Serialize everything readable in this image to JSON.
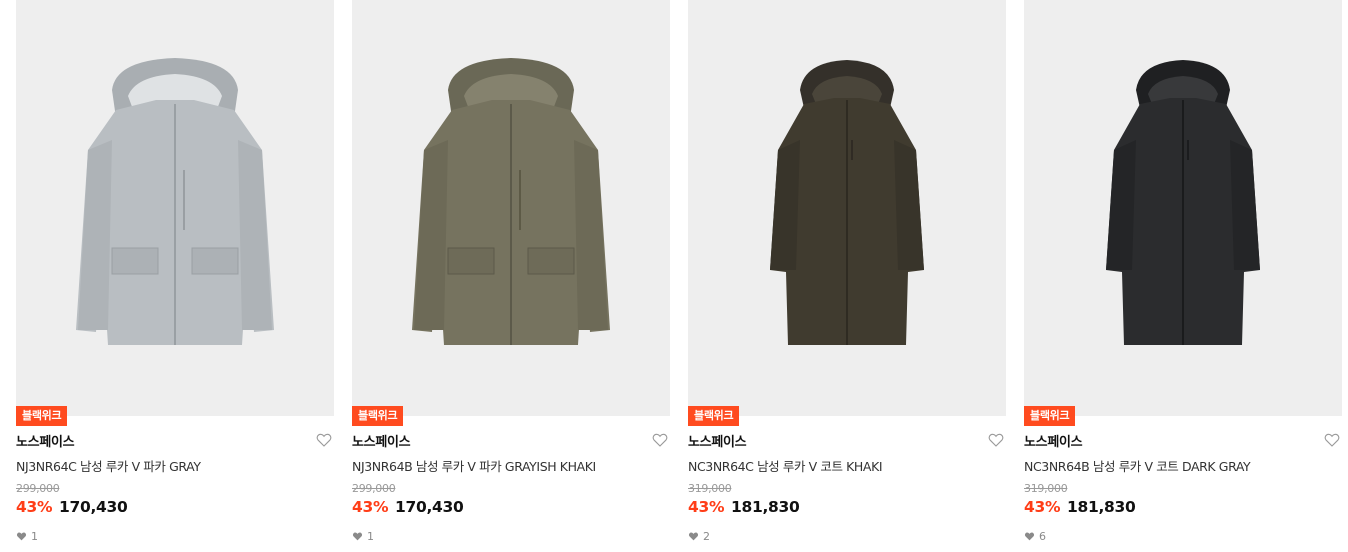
{
  "products": [
    {
      "badge": "블랙위크",
      "brand": "노스페이스",
      "name": "NJ3NR64C 남성 루카 V 파카 GRAY",
      "original_price": "299,000",
      "discount": "43%",
      "price": "170,430",
      "likes": "1",
      "image_alt": "parka-gray",
      "color": "#b9bec2"
    },
    {
      "badge": "블랙위크",
      "brand": "노스페이스",
      "name": "NJ3NR64B 남성 루카 V 파카 GRAYISH KHAKI",
      "original_price": "299,000",
      "discount": "43%",
      "price": "170,430",
      "likes": "1",
      "image_alt": "parka-grayish-khaki",
      "color": "#76735f"
    },
    {
      "badge": "블랙위크",
      "brand": "노스페이스",
      "name": "NC3NR64C 남성 루카 V 코트 KHAKI",
      "original_price": "319,000",
      "discount": "43%",
      "price": "181,830",
      "likes": "2",
      "image_alt": "coat-khaki",
      "color": "#403b2f"
    },
    {
      "badge": "블랙위크",
      "brand": "노스페이스",
      "name": "NC3NR64B 남성 루카 V 코트 DARK GRAY",
      "original_price": "319,000",
      "discount": "43%",
      "price": "181,830",
      "likes": "6",
      "image_alt": "coat-dark-gray",
      "color": "#2b2c2e"
    }
  ],
  "colors": {
    "badge": "#ff4b1f",
    "discount": "#ff3d17",
    "thumb_bg": "#eeeeee"
  }
}
